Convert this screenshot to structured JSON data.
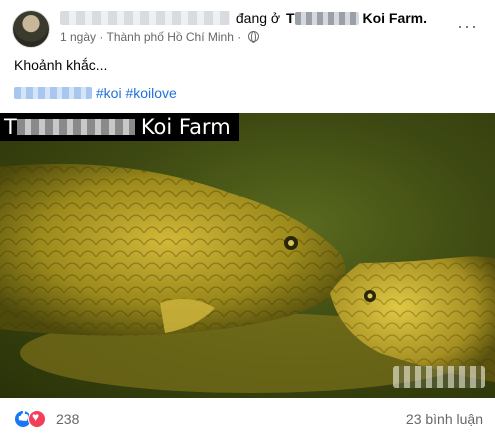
{
  "post": {
    "author_suffix": "đang ở",
    "place_visible_start": "T",
    "place_visible_end": "Koi Farm.",
    "time": "1 ngày",
    "separator": "·",
    "location": "Thành phố Hồ Chí Minh",
    "more_label": "···",
    "text": "Khoảnh khắc...",
    "hashtags": [
      "#koi",
      "#koilove"
    ]
  },
  "media": {
    "watermark_start": "T",
    "watermark_text": "Koi Farm"
  },
  "footer": {
    "reaction_count": "238",
    "comment_count": "23 bình luận"
  }
}
